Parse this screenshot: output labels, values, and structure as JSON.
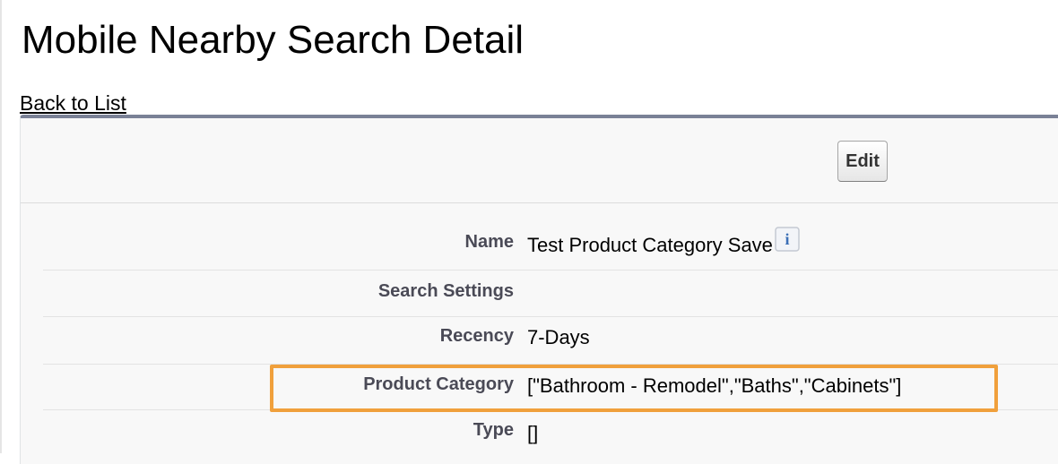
{
  "page": {
    "title": "Mobile Nearby Search Detail",
    "back_link": "Back to List"
  },
  "toolbar": {
    "edit_label": "Edit"
  },
  "fields": {
    "name": {
      "label": "Name",
      "value": "Test Product Category Save"
    },
    "search_settings": {
      "label": "Search Settings",
      "value": ""
    },
    "recency": {
      "label": "Recency",
      "value": "7-Days"
    },
    "product_category": {
      "label": "Product Category",
      "value": "[\"Bathroom - Remodel\",\"Baths\",\"Cabinets\"]"
    },
    "type": {
      "label": "Type",
      "value": "[]"
    }
  },
  "icons": {
    "info": "info-icon"
  },
  "colors": {
    "panel_top_border": "#7a8196",
    "label_text": "#4a4a56",
    "highlight": "#f0a03c",
    "info_icon": "#3b6fb6"
  }
}
